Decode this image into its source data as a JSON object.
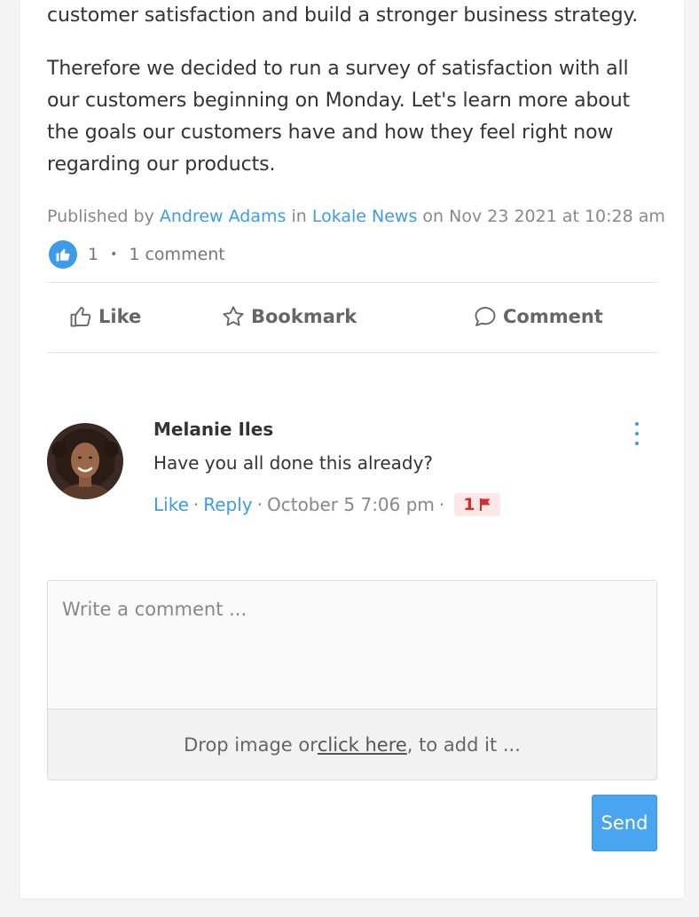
{
  "post": {
    "paragraph1": "customer satisfaction and build a stronger business strategy.",
    "paragraph2": "Therefore we decided to run a survey of satisfaction with all our customers beginning on Monday. Let's learn more about the goals our customers have and how they feel right now regarding our products.",
    "published_prefix": "Published by ",
    "author": "Andrew Adams",
    "in_text": " in ",
    "category": "Lokale News",
    "date_text": " on Nov 23 2021 at 10:28 am"
  },
  "stats": {
    "like_count": "1",
    "separator": "•",
    "comment_count": "1 comment"
  },
  "actions": {
    "like": "Like",
    "bookmark": "Bookmark",
    "comment": "Comment"
  },
  "comment": {
    "author": "Melanie Iles",
    "text": "Have you all done this already?",
    "like": "Like",
    "reply": "Reply",
    "sep": "·",
    "time": "October 5 7:06 pm",
    "flag_count": "1"
  },
  "composer": {
    "placeholder": "Write a comment ...",
    "drop_prefix": "Drop image or ",
    "drop_link": "click here",
    "drop_suffix": ", to add it ...",
    "send": "Send"
  },
  "colors": {
    "accent": "#3d9be9",
    "flag": "#d0302f",
    "flag_bg": "#fde8e8"
  }
}
